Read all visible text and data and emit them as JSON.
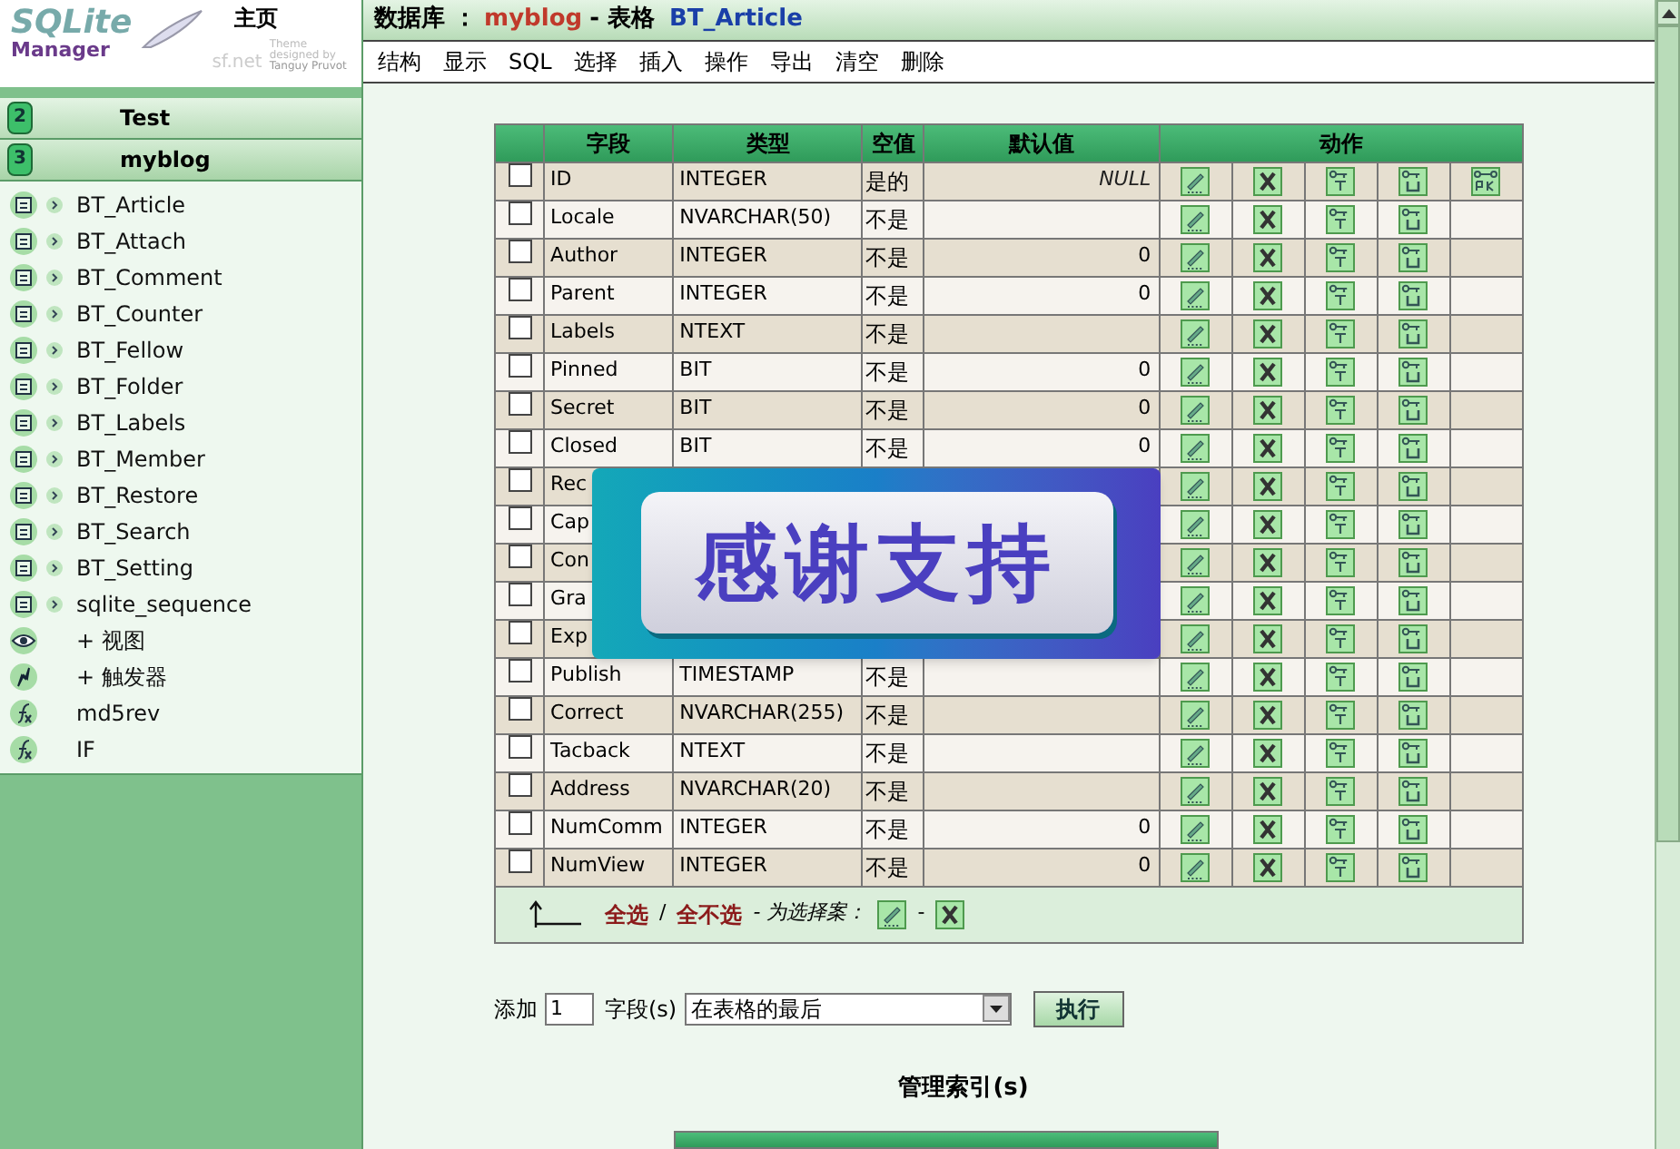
{
  "sidebar": {
    "logo": {
      "word_1": "SQLite",
      "word_2": "Manager",
      "credit_1": "Theme designed by",
      "credit_2": "Tanguy Pruvot",
      "site": "sf.net"
    },
    "home_link": "主页",
    "databases": [
      {
        "badge": "2",
        "name": "Test",
        "expanded": false
      },
      {
        "badge": "3",
        "name": "myblog",
        "expanded": true
      }
    ],
    "items": [
      {
        "kind": "table",
        "label": "BT_Article"
      },
      {
        "kind": "table",
        "label": "BT_Attach"
      },
      {
        "kind": "table",
        "label": "BT_Comment"
      },
      {
        "kind": "table",
        "label": "BT_Counter"
      },
      {
        "kind": "table",
        "label": "BT_Fellow"
      },
      {
        "kind": "table",
        "label": "BT_Folder"
      },
      {
        "kind": "table",
        "label": "BT_Labels"
      },
      {
        "kind": "table",
        "label": "BT_Member"
      },
      {
        "kind": "table",
        "label": "BT_Restore"
      },
      {
        "kind": "table",
        "label": "BT_Search"
      },
      {
        "kind": "table",
        "label": "BT_Setting"
      },
      {
        "kind": "table",
        "label": "sqlite_sequence"
      },
      {
        "kind": "view",
        "label": "+ 视图"
      },
      {
        "kind": "trigger",
        "label": "+ 触发器"
      },
      {
        "kind": "function",
        "label": "md5rev"
      },
      {
        "kind": "function",
        "label": "IF"
      }
    ]
  },
  "header": {
    "label": "数据库 ：",
    "database": "myblog",
    "separator": "- 表格",
    "table": "BT_Article"
  },
  "menu": [
    "结构",
    "显示",
    "SQL",
    "选择",
    "插入",
    "操作",
    "导出",
    "清空",
    "删除"
  ],
  "table": {
    "columns": [
      "字段",
      "类型",
      "空值",
      "默认值",
      "动作"
    ],
    "rows": [
      {
        "checked": false,
        "field": "ID",
        "type": "INTEGER",
        "null": "是的",
        "default": "NULL",
        "default_null": true,
        "pk_action": true
      },
      {
        "checked": false,
        "field": "Locale",
        "type": "NVARCHAR(50)",
        "null": "不是",
        "pk_action": false
      },
      {
        "checked": false,
        "field": "Author",
        "type": "INTEGER",
        "null": "不是",
        "default": "0",
        "pk_action": false
      },
      {
        "checked": false,
        "field": "Parent",
        "type": "INTEGER",
        "null": "不是",
        "default": "0",
        "pk_action": false
      },
      {
        "checked": false,
        "field": "Labels",
        "type": "NTEXT",
        "null": "不是",
        "pk_action": false
      },
      {
        "checked": false,
        "field": "Pinned",
        "type": "BIT",
        "null": "不是",
        "default": "0",
        "pk_action": false
      },
      {
        "checked": false,
        "field": "Secret",
        "type": "BIT",
        "null": "不是",
        "default": "0",
        "pk_action": false
      },
      {
        "checked": false,
        "field": "Closed",
        "type": "BIT",
        "null": "不是",
        "default": "0",
        "pk_action": false
      },
      {
        "checked": false,
        "field": "Rec",
        "pk_action": false
      },
      {
        "checked": false,
        "field": "Cap",
        "pk_action": false
      },
      {
        "checked": false,
        "field": "Con",
        "pk_action": false
      },
      {
        "checked": false,
        "field": "Gra",
        "pk_action": false
      },
      {
        "checked": false,
        "field": "Exp",
        "pk_action": false
      },
      {
        "checked": false,
        "field": "Publish",
        "type": "TIMESTAMP",
        "null": "不是",
        "pk_action": false
      },
      {
        "checked": false,
        "field": "Correct",
        "type": "NVARCHAR(255)",
        "null": "不是",
        "pk_action": false
      },
      {
        "checked": false,
        "field": "Tacback",
        "type": "NTEXT",
        "null": "不是",
        "pk_action": false
      },
      {
        "checked": false,
        "field": "Address",
        "type": "NVARCHAR(20)",
        "null": "不是",
        "pk_action": false
      },
      {
        "checked": false,
        "field": "NumComm",
        "type": "INTEGER",
        "null": "不是",
        "default": "0",
        "pk_action": false
      },
      {
        "checked": false,
        "field": "NumView",
        "type": "INTEGER",
        "null": "不是",
        "default": "0",
        "pk_action": false
      }
    ],
    "footer": {
      "select_all": "全选",
      "divider": "/",
      "select_none": "全不选",
      "with_selected": "- 为选择案：",
      "dash": "-"
    }
  },
  "banner": "感谢支持",
  "add_field": {
    "label": "添加",
    "count": "1",
    "unit": "字段(s)",
    "position": "在表格的最后",
    "button": "执行"
  },
  "index_heading": "管理索引(s)"
}
